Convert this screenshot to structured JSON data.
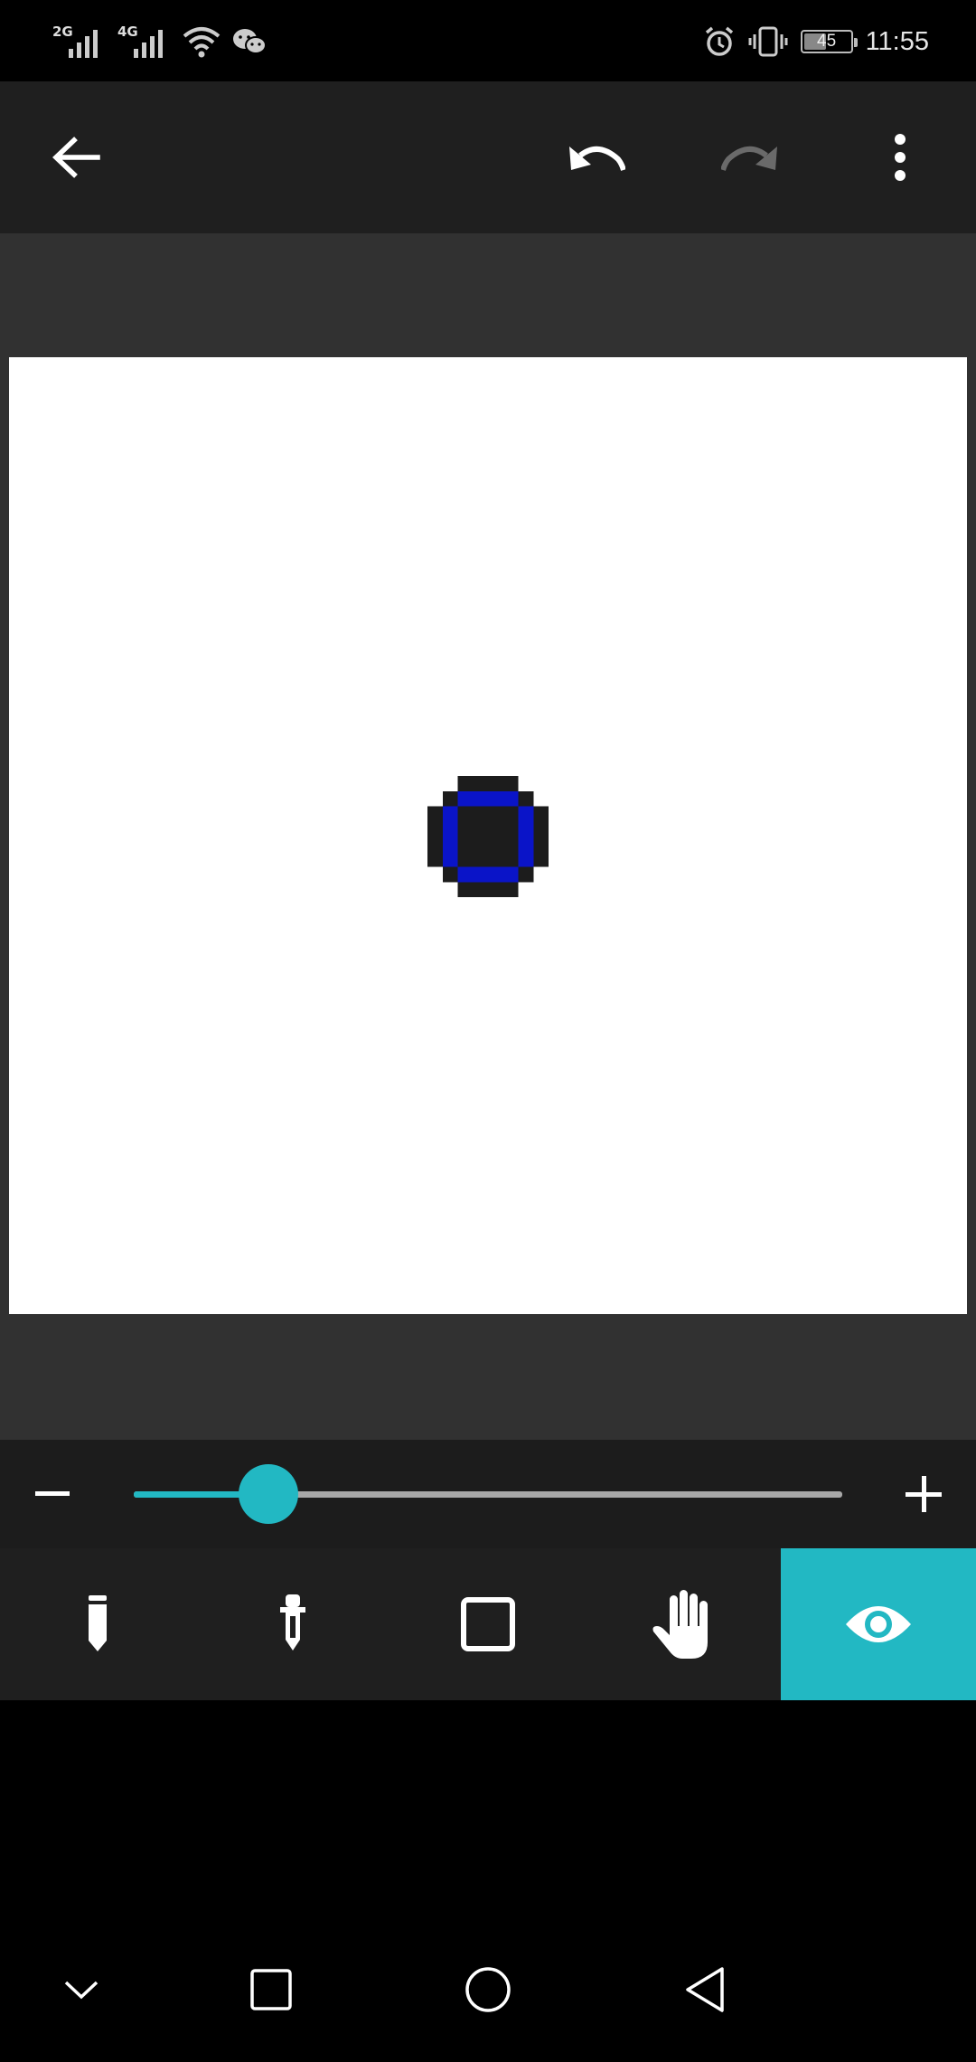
{
  "status_bar": {
    "signal1_label": "2G",
    "signal2_label": "4G",
    "battery_level": "45",
    "time": "11:55",
    "icons": [
      "signal-icon",
      "signal-icon",
      "wifi-icon",
      "wechat-icon",
      "alarm-icon",
      "vibrate-icon",
      "battery-icon"
    ]
  },
  "toolbar": {
    "icons": [
      "back-arrow-icon",
      "undo-icon",
      "redo-icon",
      "more-vert-icon"
    ],
    "redo_enabled": false
  },
  "canvas": {
    "background": "#ffffff",
    "drawing_colors": {
      "outline": "#1c1c1c",
      "ring": "#0a14c8",
      "center": "#1c1c1c"
    }
  },
  "zoom": {
    "minus_symbol": "−",
    "plus_symbol": "+",
    "level_fraction": 0.19
  },
  "tools": {
    "items": [
      "pencil-icon",
      "eyedropper-icon",
      "square-icon",
      "hand-icon",
      "eye-icon"
    ],
    "active_index": 4,
    "accent": "#22b8c3"
  },
  "nav_bar": {
    "icons": [
      "chevron-down-icon",
      "recents-square-icon",
      "home-circle-icon",
      "back-triangle-icon"
    ]
  }
}
